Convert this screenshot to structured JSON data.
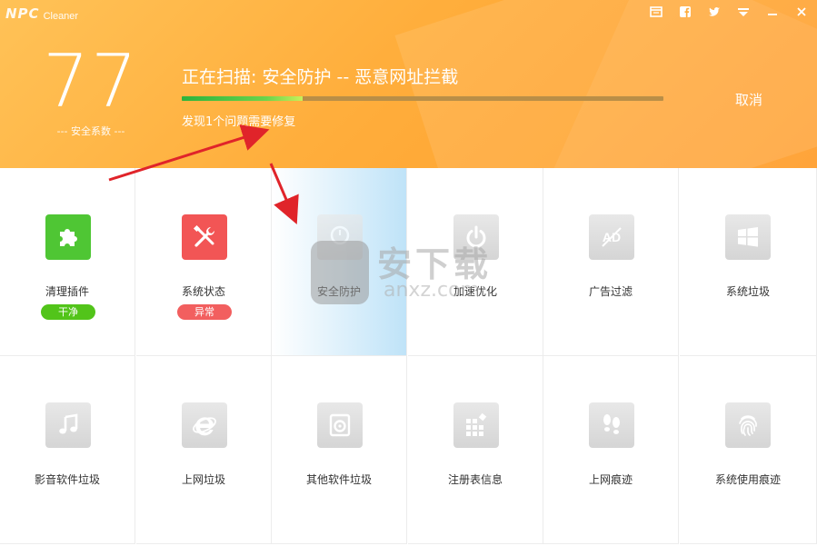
{
  "app": {
    "logo_mark": "NPC",
    "logo_text": "Cleaner"
  },
  "window_controls": [
    "feedback-icon",
    "facebook-icon",
    "twitter-icon",
    "menu-icon",
    "minimize-icon",
    "close-icon"
  ],
  "score": {
    "value": "77",
    "label": "--- 安全系数 ---"
  },
  "scan": {
    "title": "正在扫描: 安全防护 -- 恶意网址拦截",
    "progress_fraction": 0.25,
    "found": "发现1个问题需要修复",
    "cancel": "取消"
  },
  "tiles": [
    {
      "label": "清理插件",
      "icon": "puzzle-icon",
      "color": "#4fc634",
      "badge": "干净",
      "badge_color": "#52c41a"
    },
    {
      "label": "系统状态",
      "icon": "tools-icon",
      "color": "#f25555",
      "badge": "异常",
      "badge_color": "#f25f5f"
    },
    {
      "label": "安全防护",
      "icon": "shield-icon",
      "color": "",
      "badge": "",
      "badge_color": ""
    },
    {
      "label": "加速优化",
      "icon": "power-icon",
      "color": "",
      "badge": "",
      "badge_color": ""
    },
    {
      "label": "广告过滤",
      "icon": "ad-block-icon",
      "color": "",
      "badge": "",
      "badge_color": ""
    },
    {
      "label": "系统垃圾",
      "icon": "windows-icon",
      "color": "",
      "badge": "",
      "badge_color": ""
    },
    {
      "label": "影音软件垃圾",
      "icon": "music-icon",
      "color": "",
      "badge": "",
      "badge_color": ""
    },
    {
      "label": "上网垃圾",
      "icon": "ie-icon",
      "color": "",
      "badge": "",
      "badge_color": ""
    },
    {
      "label": "其他软件垃圾",
      "icon": "disc-icon",
      "color": "",
      "badge": "",
      "badge_color": ""
    },
    {
      "label": "注册表信息",
      "icon": "registry-icon",
      "color": "",
      "badge": "",
      "badge_color": ""
    },
    {
      "label": "上网痕迹",
      "icon": "footprints-icon",
      "color": "",
      "badge": "",
      "badge_color": ""
    },
    {
      "label": "系统使用痕迹",
      "icon": "fingerprint-icon",
      "color": "",
      "badge": "",
      "badge_color": ""
    }
  ],
  "watermark": {
    "text": "安下载",
    "sub": "anxz.com"
  }
}
